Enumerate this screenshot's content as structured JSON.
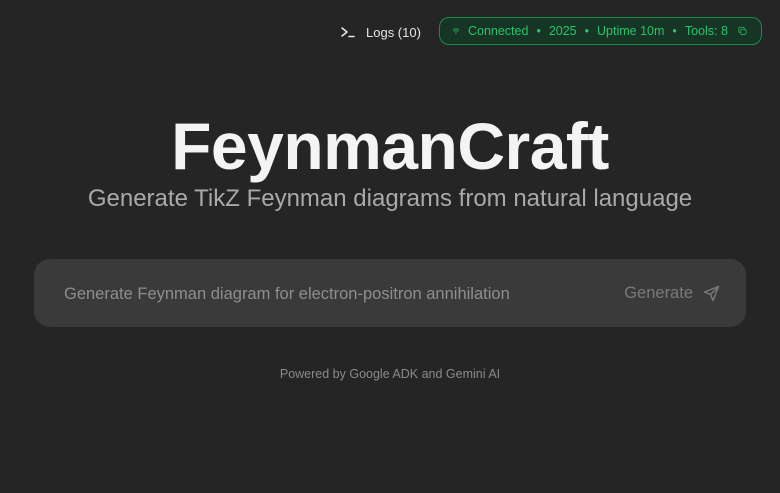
{
  "header": {
    "logs_label": "Logs (10)",
    "status": {
      "connected": "Connected",
      "port": "2025",
      "uptime": "Uptime 10m",
      "tools": "Tools: 8",
      "separator": "•",
      "color": "#27c46b"
    },
    "icons": {
      "logs": "terminal-icon",
      "status": "wifi-icon",
      "copy": "copy-icon"
    }
  },
  "hero": {
    "title": "FeynmanCraft",
    "subtitle": "Generate TikZ Feynman diagrams from natural language"
  },
  "prompt": {
    "placeholder": "Generate Feynman diagram for electron-positron annihilation",
    "value": "",
    "generate_label": "Generate",
    "generate_icon": "send-icon"
  },
  "footer": {
    "powered_by": "Powered by Google ADK and Gemini AI"
  }
}
